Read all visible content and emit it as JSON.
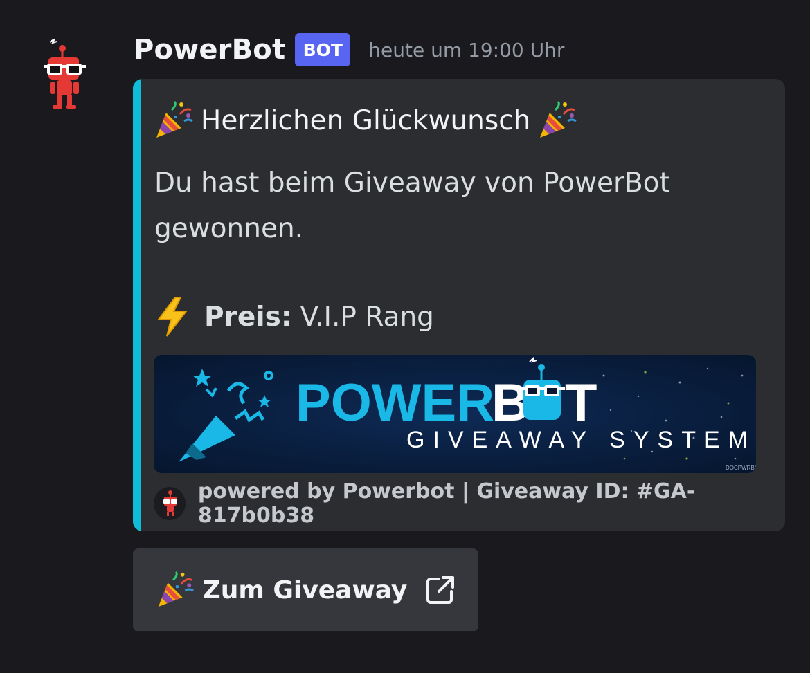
{
  "message": {
    "author": "PowerBot",
    "tag": "BOT",
    "timestamp": "heute um 19:00 Uhr"
  },
  "embed": {
    "accent_color": "#10bcd8",
    "title": "Herzlichen Glückwunsch",
    "title_emoji": "party-popper-icon",
    "description": "Du hast beim Giveaway von PowerBot gewonnen.",
    "prize_emoji": "lightning-icon",
    "prize_label": "Preis:",
    "prize_value": "V.I.P Rang",
    "banner": {
      "brand_left": "POWER",
      "brand_right": "B",
      "brand_right_end": "T",
      "subtitle": "GIVEAWAY SYSTEM",
      "credit": "DOCPWRBOT"
    },
    "footer": "powered by Powerbot | Giveaway ID: #GA-817b0b38"
  },
  "button": {
    "label": "Zum Giveaway",
    "emoji": "party-popper-icon",
    "trailing_icon": "external-link-icon"
  }
}
